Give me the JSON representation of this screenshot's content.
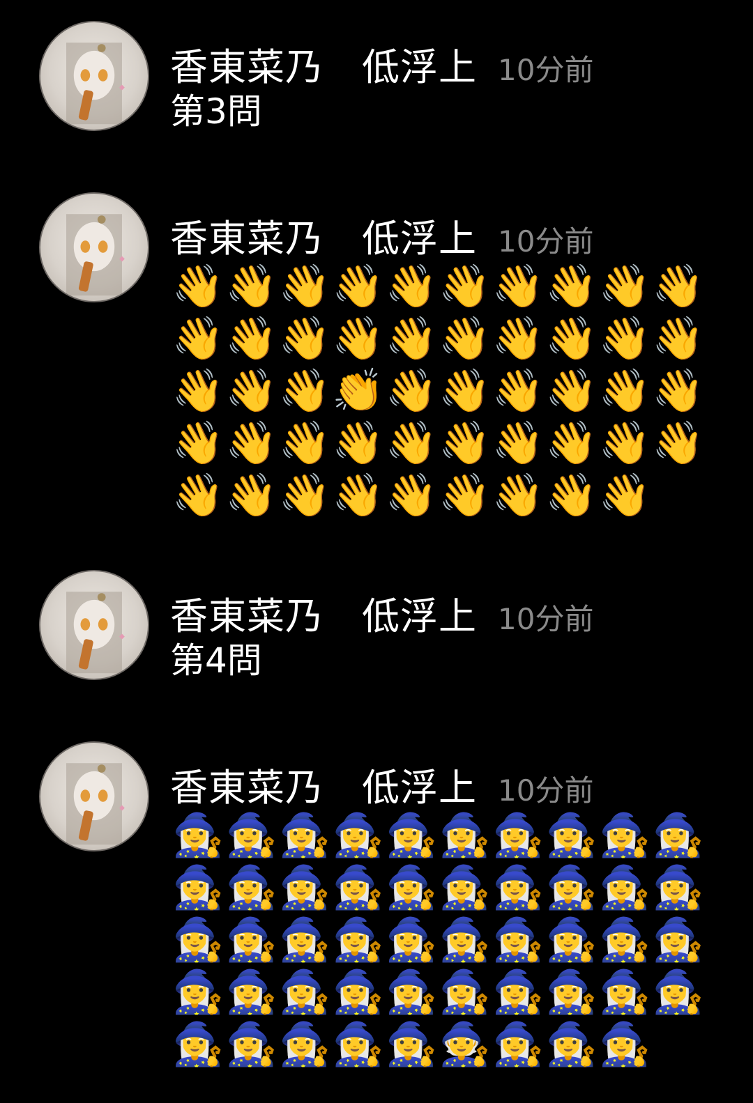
{
  "messages": [
    {
      "user": "香東菜乃　低浮上",
      "time": "10分前",
      "text": "第3問"
    },
    {
      "user": "香東菜乃　低浮上",
      "time": "10分前",
      "emojis": [
        "👋",
        "👋",
        "👋",
        "👋",
        "👋",
        "👋",
        "👋",
        "👋",
        "👋",
        "👋",
        "👋",
        "👋",
        "👋",
        "👋",
        "👋",
        "👋",
        "👋",
        "👋",
        "👋",
        "👋",
        "👋",
        "👋",
        "👋",
        "👏",
        "👋",
        "👋",
        "👋",
        "👋",
        "👋",
        "👋",
        "👋",
        "👋",
        "👋",
        "👋",
        "👋",
        "👋",
        "👋",
        "👋",
        "👋",
        "👋",
        "👋",
        "👋",
        "👋",
        "👋",
        "👋",
        "👋",
        "👋",
        "👋",
        "👋"
      ]
    },
    {
      "user": "香東菜乃　低浮上",
      "time": "10分前",
      "text": "第4問"
    },
    {
      "user": "香東菜乃　低浮上",
      "time": "10分前",
      "emojis": [
        "🧙‍♀️",
        "🧙‍♀️",
        "🧙‍♀️",
        "🧙‍♀️",
        "🧙‍♀️",
        "🧙‍♀️",
        "🧙‍♀️",
        "🧙‍♀️",
        "🧙‍♀️",
        "🧙‍♀️",
        "🧙‍♀️",
        "🧙‍♀️",
        "🧙‍♀️",
        "🧙‍♀️",
        "🧙‍♀️",
        "🧙‍♀️",
        "🧙‍♀️",
        "🧙‍♀️",
        "🧙‍♀️",
        "🧙‍♀️",
        "🧙‍♀️",
        "🧙‍♀️",
        "🧙‍♀️",
        "🧙‍♀️",
        "🧙‍♀️",
        "🧙‍♀️",
        "🧙‍♀️",
        "🧙‍♀️",
        "🧙‍♀️",
        "🧙‍♀️",
        "🧙‍♀️",
        "🧙‍♀️",
        "🧙‍♀️",
        "🧙‍♀️",
        "🧙‍♀️",
        "🧙‍♀️",
        "🧙‍♀️",
        "🧙‍♀️",
        "🧙‍♀️",
        "🧙‍♀️",
        "🧙‍♀️",
        "🧙‍♀️",
        "🧙‍♀️",
        "🧙‍♀️",
        "🧙‍♀️",
        "🧙",
        "🧙‍♀️",
        "🧙‍♀️",
        "🧙‍♀️"
      ]
    }
  ]
}
